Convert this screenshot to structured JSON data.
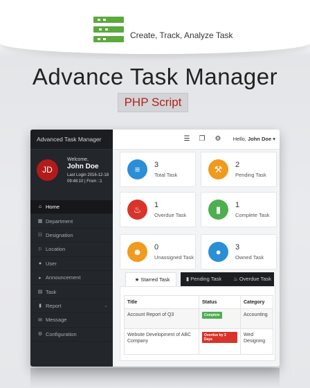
{
  "promo": {
    "tagline": "Create, Track, Analyze Task",
    "title": "Advance Task Manager",
    "badge": "PHP Script",
    "logo_color": "#5aaa3c"
  },
  "app": {
    "brand": "Advanced Task Manager",
    "user": {
      "initials": "JD",
      "welcome": "Welcome,",
      "name": "John Doe",
      "last_login": "Last Login 2016-12-18 09:48:10 | From ::1"
    },
    "topbar": {
      "icons": [
        "list-icon",
        "copy-icon",
        "gear-icon"
      ],
      "hello": "Hello,",
      "user": "John Doe"
    },
    "nav": [
      {
        "label": "Home",
        "icon": "home-icon",
        "active": true
      },
      {
        "label": "Department",
        "icon": "building-icon"
      },
      {
        "label": "Designation",
        "icon": "sitemap-icon"
      },
      {
        "label": "Location",
        "icon": "map-icon"
      },
      {
        "label": "User",
        "icon": "user-icon"
      },
      {
        "label": "Announcement",
        "icon": "bullhorn-icon"
      },
      {
        "label": "Task",
        "icon": "tasks-icon"
      },
      {
        "label": "Report",
        "icon": "chart-icon",
        "has_caret": true
      },
      {
        "label": "Message",
        "icon": "envelope-icon"
      },
      {
        "label": "Configuration",
        "icon": "cogs-icon"
      }
    ],
    "cards": [
      {
        "value": "3",
        "label": "Total Task",
        "color": "#2b8fd6",
        "icon": "layers-icon"
      },
      {
        "value": "2",
        "label": "Pending Task",
        "color": "#f09a1e",
        "icon": "wrench-icon"
      },
      {
        "value": "1",
        "label": "Overdue Task",
        "color": "#d9342b",
        "icon": "fire-icon"
      },
      {
        "value": "1",
        "label": "Complete Task",
        "color": "#4caf50",
        "icon": "battery-icon"
      },
      {
        "value": "0",
        "label": "Unassigned Task",
        "color": "#f09a1e",
        "icon": "user-plus-icon"
      },
      {
        "value": "3",
        "label": "Owned Task",
        "color": "#2b8fd6",
        "icon": "user-icon"
      }
    ],
    "tabs": [
      {
        "label": "Starred Task",
        "icon": "star-icon"
      },
      {
        "label": "Pending Task",
        "icon": "battery-icon"
      },
      {
        "label": "Overdue Task",
        "icon": "fire-icon"
      }
    ],
    "table": {
      "headers": [
        "Title",
        "Status",
        "Category"
      ],
      "rows": [
        {
          "title": "Account Report of Q3",
          "status": "Complete",
          "status_color": "#4caf50",
          "category": "Accounting"
        },
        {
          "title": "Website Development of ABC Company",
          "status": "Overdue by 3 Days",
          "status_color": "#d9342b",
          "category": "Wed Designing"
        }
      ]
    }
  }
}
